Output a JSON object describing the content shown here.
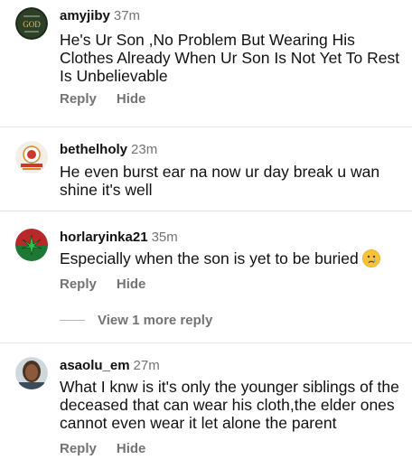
{
  "comments": [
    {
      "username": "amyjiby",
      "time": "37m",
      "text": "He's Ur Son ,No Problem But Wearing His Clothes Already When Ur Son Is Not Yet To Rest Is Unbelievable",
      "reply_label": "Reply",
      "hide_label": "Hide",
      "avatar_text": "GOD"
    },
    {
      "username": "bethelholy",
      "time": "23m",
      "text": "He even burst ear na now ur day break u wan shine it's well"
    },
    {
      "username": "horlaryinka21",
      "time": "35m",
      "text": "Especially when the son is yet to be buried",
      "emoji": "crying-face-icon",
      "reply_label": "Reply",
      "hide_label": "Hide"
    },
    {
      "username": "asaolu_em",
      "time": "27m",
      "text": "What I knw is it's only the younger siblings of the deceased that can wear his cloth,the elder ones cannot even wear it let alone the parent",
      "reply_label": "Reply",
      "hide_label": "Hide"
    }
  ],
  "view_more_label": "View 1 more reply",
  "colors": {
    "text": "#111111",
    "muted": "#737373",
    "divider": "#e3e3e3"
  }
}
